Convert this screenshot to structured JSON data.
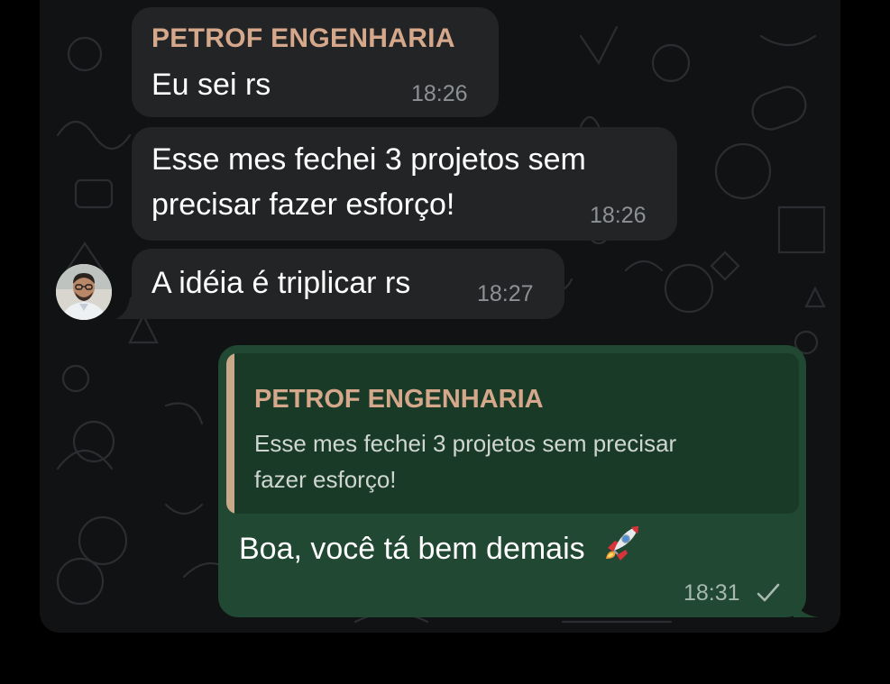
{
  "messages": [
    {
      "sender": "PETROF ENGENHARIA",
      "text": "Eu sei rs",
      "time": "18:26"
    },
    {
      "text_line1": "Esse mes fechei 3 projetos sem",
      "text_line2": "precisar fazer esforço!",
      "time": "18:26"
    },
    {
      "text": "A idéia é triplicar rs",
      "time": "18:27"
    }
  ],
  "reply": {
    "quoted_sender": "PETROF ENGENHARIA",
    "quoted_line1": "Esse mes fechei 3 projetos sem precisar",
    "quoted_line2": "fazer esforço!",
    "text": "Boa, você tá bem demais",
    "emoji": "rocket",
    "time": "18:31",
    "status": "sent-check"
  },
  "colors": {
    "background": "#111214",
    "incoming_bubble": "#222426",
    "outgoing_bubble": "#214832",
    "sender_name": "#d6a88b"
  }
}
